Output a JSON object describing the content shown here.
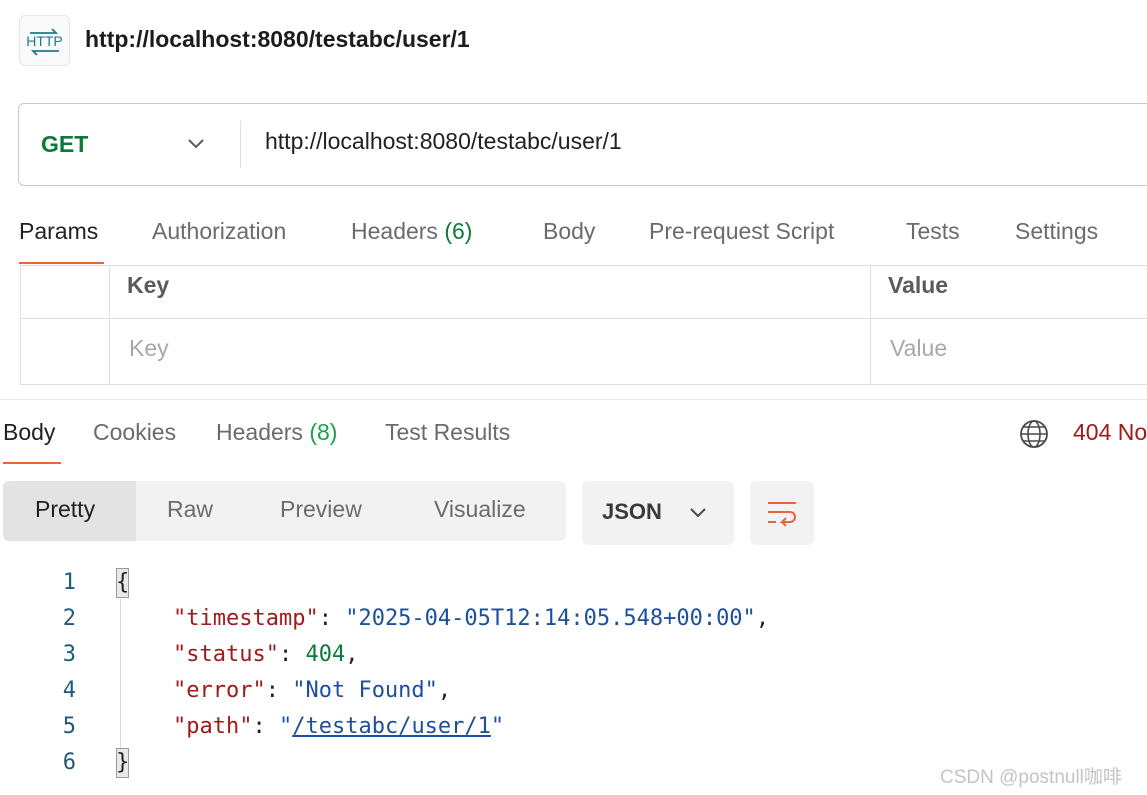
{
  "header": {
    "icon": "http-icon",
    "icon_text": "HTTP",
    "title": "http://localhost:8080/testabc/user/1"
  },
  "request": {
    "method": "GET",
    "url": "http://localhost:8080/testabc/user/1",
    "tabs": [
      {
        "label": "Params",
        "active": true
      },
      {
        "label": "Authorization"
      },
      {
        "label": "Headers",
        "count": "(6)"
      },
      {
        "label": "Body"
      },
      {
        "label": "Pre-request Script"
      },
      {
        "label": "Tests"
      },
      {
        "label": "Settings"
      }
    ]
  },
  "params_table": {
    "headers": [
      "Key",
      "Value"
    ],
    "placeholders": [
      "Key",
      "Value"
    ]
  },
  "response": {
    "tabs": [
      {
        "label": "Body",
        "active": true
      },
      {
        "label": "Cookies"
      },
      {
        "label": "Headers",
        "count": "(8)"
      },
      {
        "label": "Test Results"
      }
    ],
    "status": "404 No",
    "views": [
      "Pretty",
      "Raw",
      "Preview",
      "Visualize"
    ],
    "active_view": "Pretty",
    "format": "JSON",
    "body": {
      "line_numbers": [
        "1",
        "2",
        "3",
        "4",
        "5",
        "6"
      ],
      "open_brace": "{",
      "close_brace": "}",
      "fields": [
        {
          "key": "\"timestamp\"",
          "value": "\"2025-04-05T12:14:05.548+00:00\"",
          "trail": ","
        },
        {
          "key": "\"status\"",
          "value": "404",
          "trail": ","
        },
        {
          "key": "\"error\"",
          "value": "\"Not Found\"",
          "trail": ","
        },
        {
          "key": "\"path\"",
          "value_link": "/testabc/user/1",
          "trail": ""
        }
      ]
    }
  },
  "colors": {
    "accent": "#e8643a",
    "method_green": "#0b7a3a",
    "status_red": "#a11a1a",
    "json_key": "#a11a1a",
    "json_string": "#1c4f9c"
  },
  "watermark": "CSDN @postnull咖啡"
}
